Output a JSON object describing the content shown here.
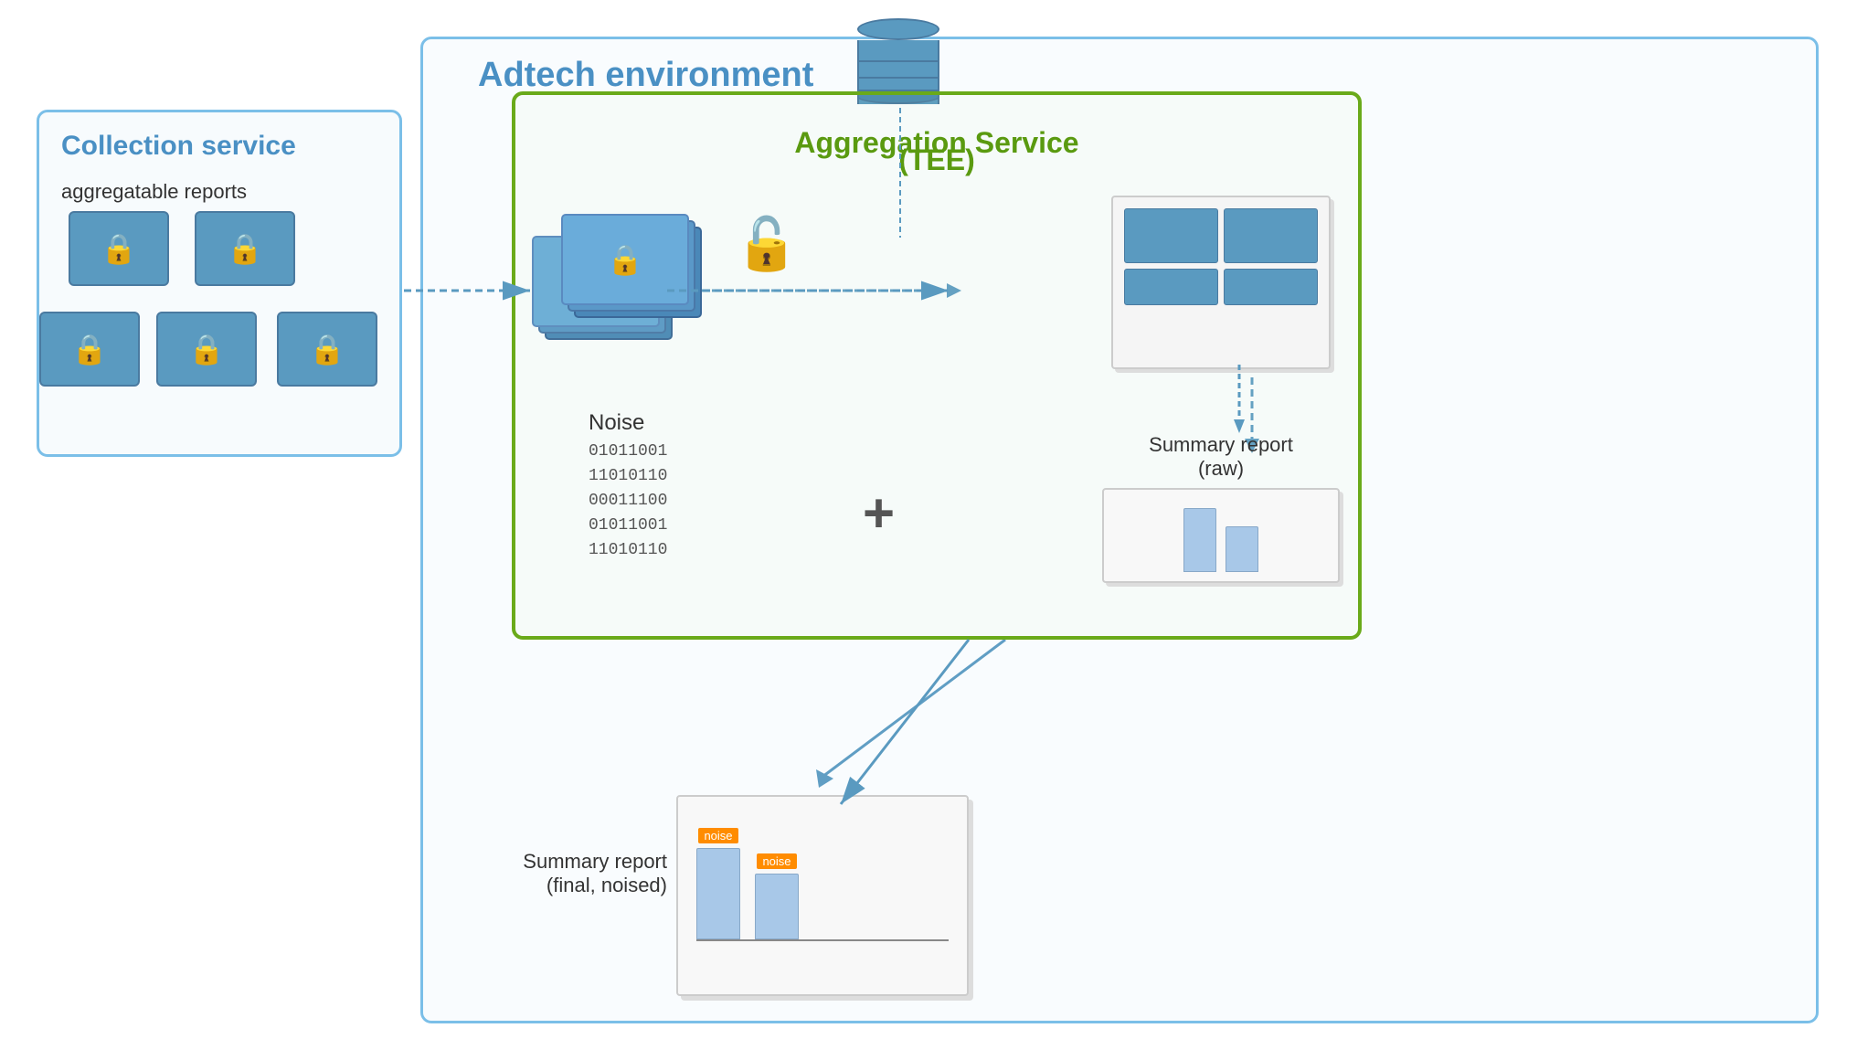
{
  "adtech_env": {
    "label": "Adtech environment"
  },
  "collection_service": {
    "label": "Collection service",
    "sublabel": "aggregatable reports"
  },
  "aggregation_service": {
    "label": "Aggregation Service",
    "label2": "(TEE)"
  },
  "noise": {
    "label": "Noise",
    "binary": [
      "01011001",
      "11010110",
      "00011100",
      "01011001",
      "11010110"
    ]
  },
  "summary_raw": {
    "label": "Summary report",
    "sublabel": "(raw)"
  },
  "summary_final": {
    "label": "Summary report",
    "sublabel": "(final, noised)"
  },
  "noise_indicators": [
    "noise",
    "noise"
  ],
  "plus_sign": "+"
}
